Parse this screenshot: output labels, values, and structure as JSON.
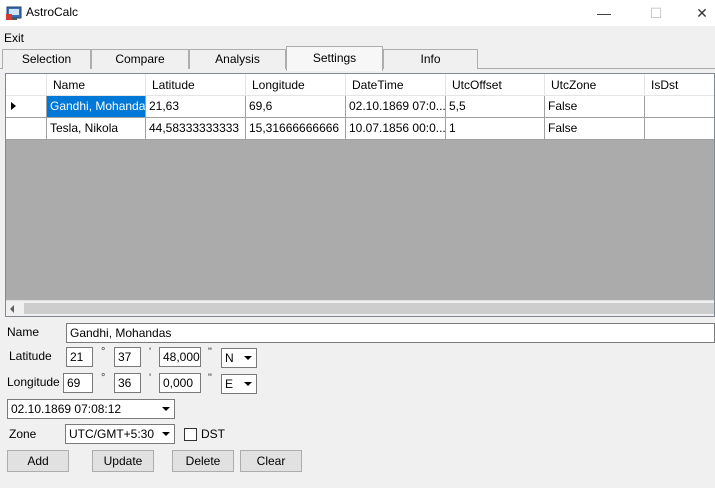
{
  "window": {
    "title": "AstroCalc",
    "minimize": "—",
    "maximize": "☐",
    "close": "✕"
  },
  "menu": {
    "exit": "Exit"
  },
  "tabs": [
    {
      "label": "Selection"
    },
    {
      "label": "Compare"
    },
    {
      "label": "Analysis"
    },
    {
      "label": "Settings"
    },
    {
      "label": "Info"
    }
  ],
  "grid": {
    "columns": [
      "Name",
      "Latitude",
      "Longitude",
      "DateTime",
      "UtcOffset",
      "UtcZone",
      "IsDst"
    ],
    "rows": [
      [
        "Gandhi, Mohandas",
        "21,63",
        "69,6",
        "02.10.1869 07:0...",
        "5,5",
        "False",
        ""
      ],
      [
        "Tesla, Nikola",
        "44,58333333333",
        "15,31666666666",
        "10.07.1856 00:0...",
        "1",
        "False",
        ""
      ]
    ]
  },
  "form": {
    "name_label": "Name",
    "name_value": "Gandhi, Mohandas",
    "latitude_label": "Latitude",
    "lat_deg": "21",
    "lat_min": "37",
    "lat_sec": "48,000",
    "lat_dir": "N",
    "longitude_label": "Longitude",
    "lon_deg": "69",
    "lon_min": "36",
    "lon_sec": "0,000",
    "lon_dir": "E",
    "degree_symbol": "°",
    "minute_symbol": "'",
    "second_symbol": "\"",
    "datetime_value": "02.10.1869 07:08:12",
    "zone_label": "Zone",
    "zone_value": "UTC/GMT+5:30",
    "dst_label": "DST",
    "add": "Add",
    "update": "Update",
    "delete": "Delete",
    "clear": "Clear"
  }
}
